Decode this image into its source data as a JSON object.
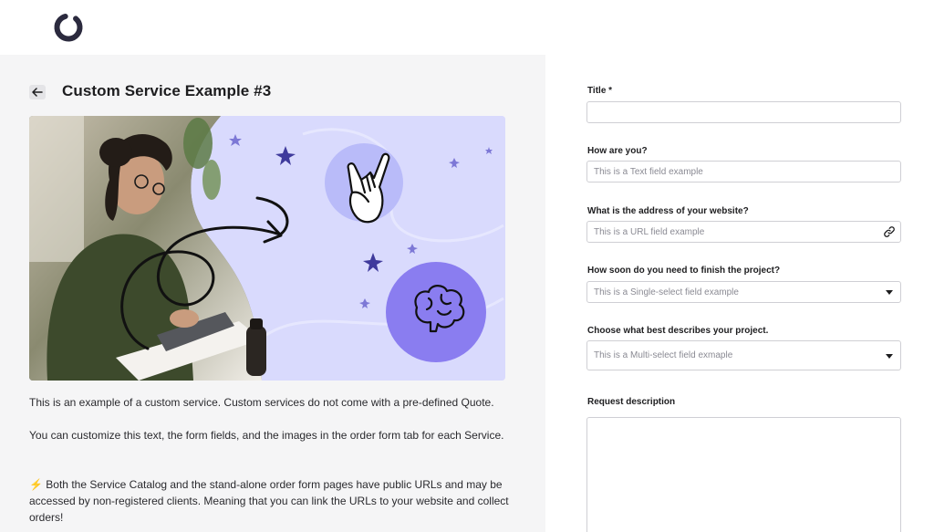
{
  "app": {
    "logo_icon": "circle-logo-icon"
  },
  "header": {
    "back_icon": "arrow-left-icon",
    "title": "Custom Service Example #3"
  },
  "colors": {
    "panel_bg": "#f5f5f6",
    "hero_bg": "#d9dafd",
    "accent": "#8a7df0",
    "star": "#3f3a9c",
    "zap": "#f5a623"
  },
  "hero": {
    "icons": [
      "rock-hand-icon",
      "brain-icon",
      "star-icon",
      "curly-arrow-icon"
    ]
  },
  "description": {
    "p1": "This is an example of a custom service. Custom services do not come with a pre-defined Quote.",
    "p2": "You can customize this text, the form fields, and the images in the order form tab for each Service.",
    "p3_icon": "⚡",
    "p3": "Both the Service Catalog and the stand-alone order form pages have public URLs and may be accessed by non-registered clients. Meaning that you can link the URLs to your website and collect orders!"
  },
  "form": {
    "title": {
      "label": "Title",
      "required_mark": "*",
      "value": ""
    },
    "how_are_you": {
      "label": "How are you?",
      "placeholder": "This is a Text field example"
    },
    "website": {
      "label": "What is the address of your website?",
      "placeholder": "This is a URL field example",
      "icon": "link-icon"
    },
    "how_soon": {
      "label": "How soon do you need to finish the project?",
      "placeholder": "This is a Single-select field example"
    },
    "describes": {
      "label": "Choose what best describes your project.",
      "placeholder": "This is a Multi-select field exmaple"
    },
    "request": {
      "label": "Request description",
      "value": ""
    }
  }
}
